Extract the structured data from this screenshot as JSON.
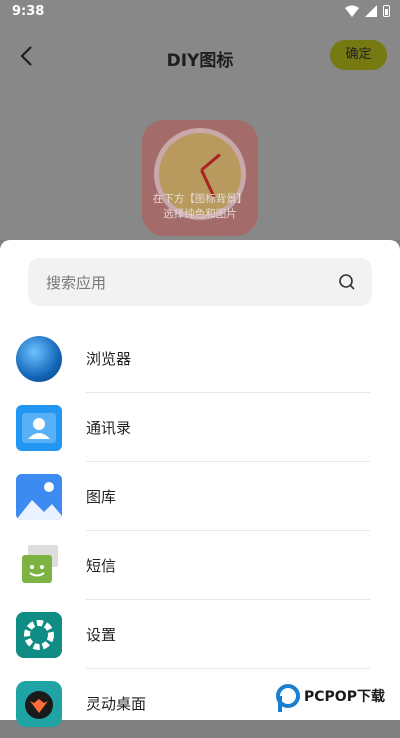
{
  "status": {
    "time": "9:38"
  },
  "header": {
    "title": "DIY图标",
    "confirm_label": "确定"
  },
  "preview": {
    "hint_line1": "在下方【图标背景】",
    "hint_line2": "选择纯色和图片"
  },
  "search": {
    "placeholder": "搜索应用"
  },
  "apps": [
    {
      "label": "浏览器",
      "icon": "browser-icon"
    },
    {
      "label": "通讯录",
      "icon": "contacts-icon"
    },
    {
      "label": "图库",
      "icon": "gallery-icon"
    },
    {
      "label": "短信",
      "icon": "sms-icon"
    },
    {
      "label": "设置",
      "icon": "settings-icon"
    },
    {
      "label": "灵动桌面",
      "icon": "lingdong-desktop-icon"
    }
  ],
  "watermark": {
    "text": "PCPOP下载"
  },
  "colors": {
    "accent": "#767a10",
    "sheet": "#ffffff",
    "scrim": "#808080"
  }
}
